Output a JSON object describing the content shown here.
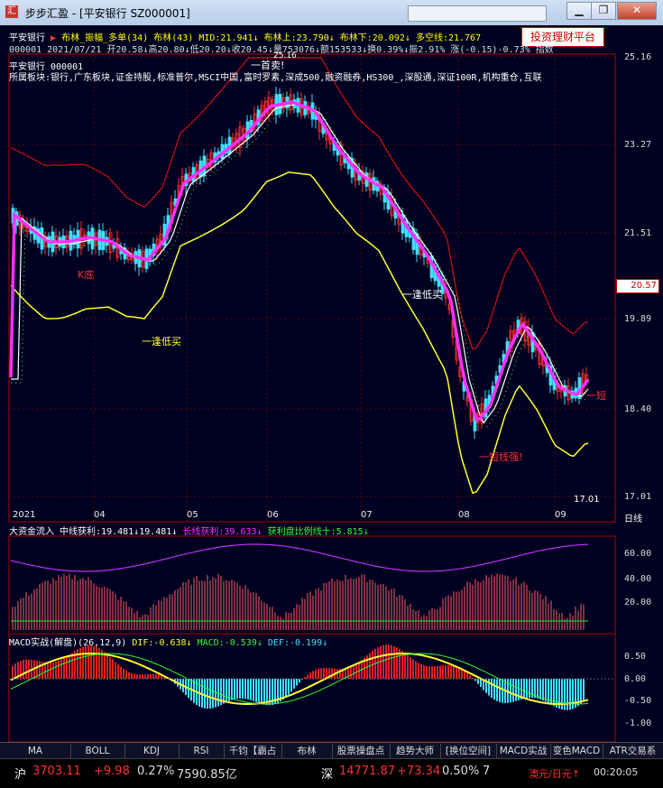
{
  "window": {
    "app_name": "步步汇盈",
    "title": "步步汇盈 - [平安银行 SZ000001]",
    "app_icon_glyph": "汇",
    "min_label": "▁",
    "restore_label": "❐",
    "close_label": "✕"
  },
  "toolbar": {
    "invest_button": "投资理财平台"
  },
  "header": {
    "stock_name": "平安银行",
    "indicator_line": "布林_振幅_多单(34) 布林(43) MID:21.941↓ 布林上:23.790↓ 布林下:20.092↓ 多空线:21.767",
    "quote_line": "000001 2021/07/21 开20.58↓高20.80↓低20.20↓收20.45↓量753076↓额153533↓换0.39%↓振2.91% 涨(-0.15)-0.73% 指数",
    "name_code": "平安银行 000001",
    "sectors": "所属板块:银行,广东板块,证金持股,标准普尔,MSCI中国,富时罗素,深成500,融资融券,HS300_,深股通,深证100R,机构重仓,互联"
  },
  "main_chart": {
    "y_ticks": [
      "25.16",
      "23.27",
      "21.51",
      "19.89",
      "18.40",
      "17.01"
    ],
    "current_price": "20.57",
    "x_ticks": [
      "2021",
      "04",
      "05",
      "06",
      "07",
      "08",
      "09"
    ],
    "period_label": "日线",
    "annotations": [
      {
        "text": "K底",
        "color": "#ff3030"
      },
      {
        "text": "一逢低买",
        "color": "#ffff40"
      },
      {
        "text": "一逢低买",
        "color": "#ffffff"
      },
      {
        "text": "一首卖!",
        "color": "#ffffff"
      },
      {
        "text": "一短线强!",
        "color": "#ff3030"
      },
      {
        "text": "一短",
        "color": "#ff3030"
      },
      {
        "text": "17.01",
        "color": "#ffffff"
      },
      {
        "text": "25.16",
        "color": "#ffffff"
      }
    ]
  },
  "flow_panel": {
    "label": "大资金流入",
    "mid_label": "中线获利:19.481↓19.481↓",
    "long_label": "长线获利:39.633↓",
    "ratio_label": "获利盘比例线十:5.815↓",
    "y_ticks": [
      "60.00",
      "40.00",
      "20.00"
    ]
  },
  "macd_panel": {
    "label": "MACD实战(解盘)(26,12,9)",
    "dif_label": "DIF:-0.638↓",
    "macd_label": "MACD:-0.539↓",
    "dea_label": "DEF:-0.199↓",
    "y_ticks": [
      "0.50",
      "0.00",
      "-0.50",
      "-1.00"
    ]
  },
  "tabs": [
    "MA",
    "BOLL",
    "KDJ",
    "RSI",
    "千钧【霸占",
    "布林",
    "股票操盘点",
    "趋势大师",
    "[换位空间]",
    "MACD实战",
    "变色MACD",
    "ATR交易系"
  ],
  "status": {
    "sh_label": "沪",
    "sh_index": "3703.11",
    "sh_change": "+9.98",
    "sh_pct": "0.27%",
    "sh_amount": "7590.85亿",
    "sz_label": "深",
    "sz_index": "14771.87",
    "sz_change": "+73.34",
    "sz_pct": "0.50%",
    "sz_extra": "7",
    "currency": "澳元/日元↑",
    "clock": "00:20:05"
  },
  "colors": {
    "up": "#ff3030",
    "down": "#40e0ff",
    "ma_magenta": "#ff30ff",
    "boll_upper": "#d01010",
    "boll_lower": "#ffff30",
    "mid": "#ffffff",
    "dots": "#30ff30"
  }
}
